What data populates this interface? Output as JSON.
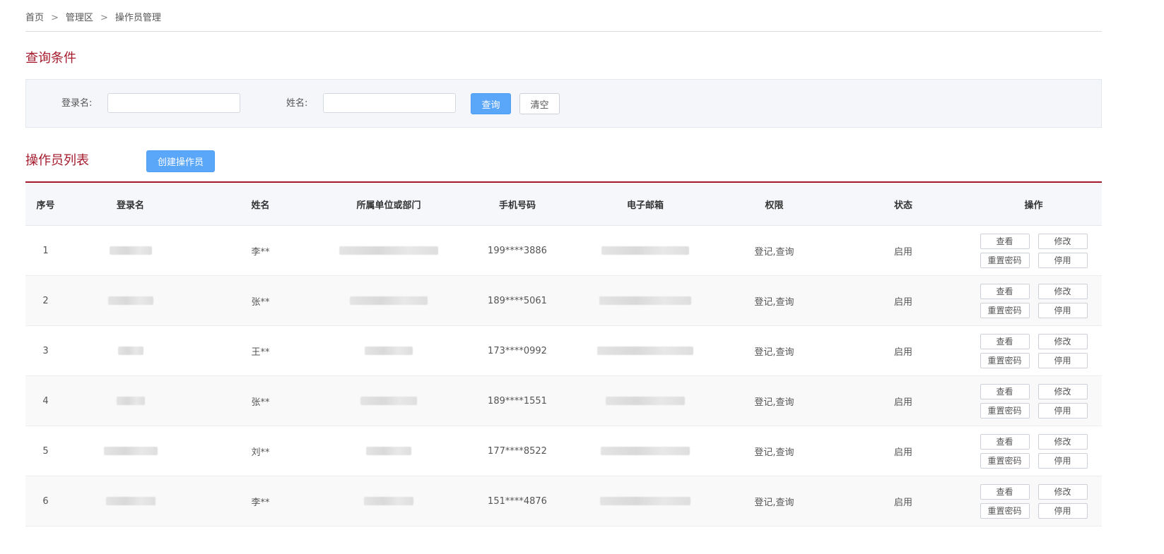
{
  "breadcrumb": {
    "items": [
      "首页",
      "管理区",
      "操作员管理"
    ],
    "separator": ">"
  },
  "query_section": {
    "title": "查询条件",
    "login_label": "登录名:",
    "login_value": "",
    "name_label": "姓名:",
    "name_value": "",
    "search_button": "查询",
    "clear_button": "清空"
  },
  "list_section": {
    "title": "操作员列表",
    "create_button": "创建操作员",
    "columns": [
      "序号",
      "登录名",
      "姓名",
      "所属单位或部门",
      "手机号码",
      "电子邮箱",
      "权限",
      "状态",
      "操作"
    ],
    "rows": [
      {
        "index": "1",
        "name": "李**",
        "phone": "199****3886",
        "permission": "登记,查询",
        "status": "启用"
      },
      {
        "index": "2",
        "name": "张**",
        "phone": "189****5061",
        "permission": "登记,查询",
        "status": "启用"
      },
      {
        "index": "3",
        "name": "王**",
        "phone": "173****0992",
        "permission": "登记,查询",
        "status": "启用"
      },
      {
        "index": "4",
        "name": "张**",
        "phone": "189****1551",
        "permission": "登记,查询",
        "status": "启用"
      },
      {
        "index": "5",
        "name": "刘**",
        "phone": "177****8522",
        "permission": "登记,查询",
        "status": "启用"
      },
      {
        "index": "6",
        "name": "李**",
        "phone": "151****4876",
        "permission": "登记,查询",
        "status": "启用"
      }
    ],
    "row_actions": {
      "view": "查看",
      "edit": "修改",
      "reset_password": "重置密码",
      "disable": "停用"
    }
  },
  "colors": {
    "accent": "#a41a2c",
    "primary_button": "#5aa6f8"
  }
}
